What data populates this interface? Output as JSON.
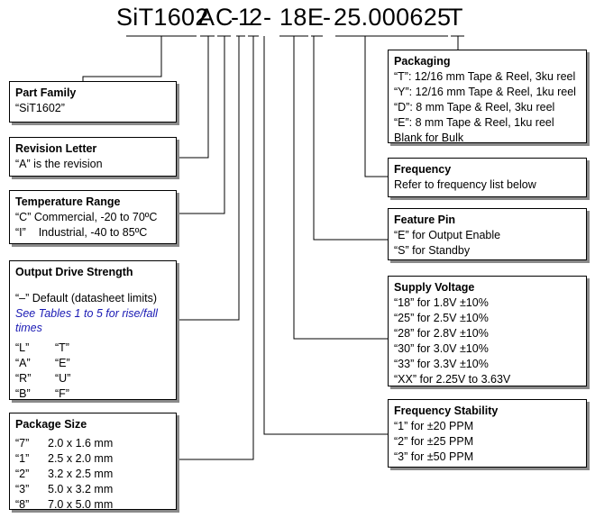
{
  "part_number": {
    "full": "SiT1602AC-12-18E-25.000625T",
    "segments": {
      "family": "SiT1602",
      "revision": "A",
      "temperature": "C",
      "dash1": "-",
      "drive": "1",
      "package": "2",
      "dash2": "-",
      "voltage": "18",
      "feature": "E",
      "dash3": "-",
      "frequency": "25.000625",
      "packaging": "T"
    }
  },
  "boxes": {
    "part_family": {
      "title": "Part Family",
      "lines": [
        "“SiT1602”"
      ]
    },
    "revision_letter": {
      "title": "Revision Letter",
      "lines": [
        "“A” is the revision"
      ]
    },
    "temperature_range": {
      "title": "Temperature Range",
      "lines": [
        "“C” Commercial, -20 to 70ºC",
        "“I”    Industrial, -40 to 85ºC"
      ]
    },
    "output_drive": {
      "title": "Output Drive Strength",
      "default": "“–” Default (datasheet limits)",
      "note": "See Tables 1 to 5 for rise/fall times",
      "codes": [
        "“L”",
        "“T”",
        "“A”",
        "“E”",
        "“R”",
        "“U”",
        "“B”",
        "“F”"
      ]
    },
    "package_size": {
      "title": "Package Size",
      "rows": [
        {
          "code": "“7”",
          "size": "2.0 x 1.6 mm"
        },
        {
          "code": "“1”",
          "size": "2.5 x 2.0 mm"
        },
        {
          "code": "“2”",
          "size": "3.2 x 2.5 mm"
        },
        {
          "code": "“3”",
          "size": "5.0 x 3.2 mm"
        },
        {
          "code": "“8”",
          "size": "7.0 x 5.0 mm"
        }
      ]
    },
    "packaging": {
      "title": "Packaging",
      "lines": [
        "“T”: 12/16 mm Tape & Reel, 3ku reel",
        "“Y”: 12/16 mm Tape & Reel, 1ku reel",
        "“D”: 8 mm Tape & Reel, 3ku reel",
        "“E”: 8 mm Tape & Reel, 1ku reel",
        "Blank for Bulk"
      ]
    },
    "frequency": {
      "title": "Frequency",
      "lines": [
        "Refer to frequency list below"
      ]
    },
    "feature_pin": {
      "title": "Feature Pin",
      "lines": [
        "“E” for Output Enable",
        "“S” for Standby"
      ]
    },
    "supply_voltage": {
      "title": "Supply Voltage",
      "lines": [
        "“18” for 1.8V ±10%",
        "“25” for 2.5V ±10%",
        "“28” for 2.8V ±10%",
        "“30” for 3.0V ±10%",
        "“33” for 3.3V ±10%",
        "“XX” for 2.25V to 3.63V"
      ]
    },
    "frequency_stability": {
      "title": "Frequency Stability",
      "lines": [
        "“1” for ±20 PPM",
        "“2” for ±25 PPM",
        "“3” for ±50 PPM"
      ]
    }
  }
}
